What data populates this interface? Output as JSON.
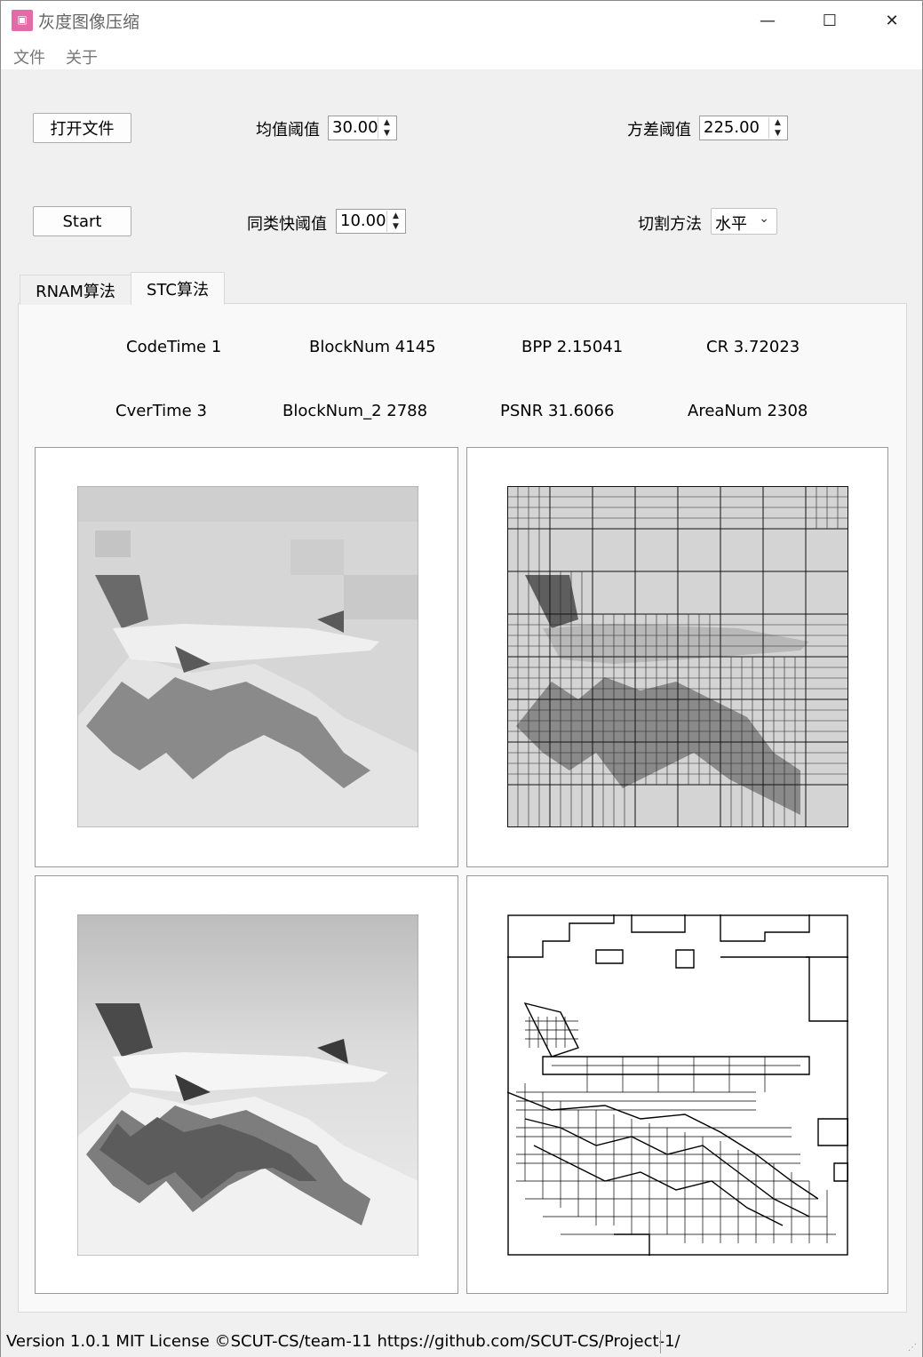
{
  "window": {
    "title": "灰度图像压缩",
    "icon_name": "picture-app-icon",
    "minimize_glyph": "—",
    "maximize_glyph": "☐",
    "close_glyph": "✕"
  },
  "menu": {
    "items": [
      "文件",
      "关于"
    ]
  },
  "controls": {
    "open_file_label": "打开文件",
    "start_label": "Start",
    "mean_threshold_label": "均值阈值",
    "mean_threshold_value": "30.00",
    "variance_threshold_label": "方差阈值",
    "variance_threshold_value": "225.00",
    "similar_block_threshold_label": "同类快阈值",
    "similar_block_threshold_value": "10.00",
    "cut_method_label": "切割方法",
    "cut_method_value": "水平"
  },
  "tabs": [
    {
      "label": "RNAM算法",
      "active": false
    },
    {
      "label": "STC算法",
      "active": true
    }
  ],
  "stats": {
    "code_time": "CodeTime  1",
    "block_num": "BlockNum  4145",
    "bpp": "BPP  2.15041",
    "cr": "CR  3.72023",
    "cver_time": "CverTime  3",
    "block_num_2": "BlockNum_2  2788",
    "psnr": "PSNR  31.6066",
    "area_num": "AreaNum  2308"
  },
  "images": [
    "compressed-image",
    "segmentation-grid-image",
    "original-image",
    "region-outline-image"
  ],
  "status": {
    "text": "Version 1.0.1 MIT License ©SCUT-CS/team-11 https://github.com/SCUT-CS/Project-1/"
  }
}
